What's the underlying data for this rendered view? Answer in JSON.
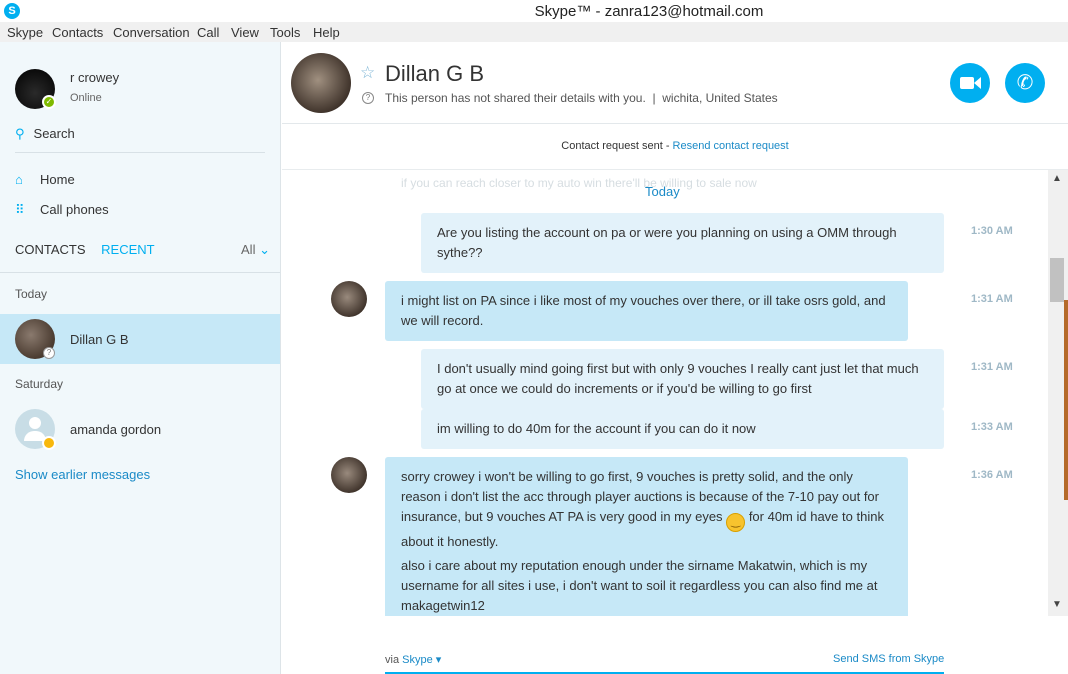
{
  "window": {
    "title": "Skype™ - zanra123@hotmail.com",
    "app_icon": "skype-icon"
  },
  "menu": [
    "Skype",
    "Contacts",
    "Conversation",
    "Call",
    "View",
    "Tools",
    "Help"
  ],
  "sidebar": {
    "profile": {
      "name": "r crowey",
      "status": "Online"
    },
    "search_label": "Search",
    "nav": [
      {
        "label": "Home",
        "icon": "home-icon"
      },
      {
        "label": "Call phones",
        "icon": "dialpad-icon"
      }
    ],
    "tabs": {
      "contacts": "CONTACTS",
      "recent": "RECENT",
      "filter": "All"
    },
    "groups": [
      {
        "label": "Today",
        "items": [
          {
            "name": "Dillan G B",
            "selected": true
          }
        ]
      },
      {
        "label": "Saturday",
        "items": [
          {
            "name": "amanda gordon",
            "selected": false
          }
        ]
      }
    ],
    "show_earlier": "Show earlier messages"
  },
  "contact": {
    "name": "Dillan G B",
    "details_note": "This person has not shared their details with you.",
    "location": "wichita, United States"
  },
  "request_bar": {
    "text": "Contact request sent - ",
    "link": "Resend contact request"
  },
  "conversation": {
    "ghost_text": "if you can reach closer to my auto win there'll be willing to sale now",
    "date_divider": "Today",
    "messages": [
      {
        "dir": "out",
        "time": "1:30 AM",
        "paragraphs": [
          "Are you listing the account on pa or were you planning on using a OMM through sythe??"
        ]
      },
      {
        "dir": "in",
        "time": "1:31 AM",
        "paragraphs": [
          "i might list on PA since i like most of my vouches over there, or ill take osrs gold, and we will record."
        ]
      },
      {
        "dir": "out",
        "time": "1:31 AM",
        "paragraphs": [
          "I don't usually mind going first but with only 9 vouches I really cant just let that much go at once we could do increments or if you'd be willing to go first"
        ]
      },
      {
        "dir": "out",
        "time": "1:33 AM",
        "paragraphs": [
          "im willing to do 40m for the account if you can do it now"
        ]
      },
      {
        "dir": "in",
        "time": "1:36 AM",
        "paragraphs": [
          "sorry crowey i won't be willing to go first, 9 vouches is pretty solid, and the only reason i don't list the acc through player auctions is because of the 7-10 pay out for insurance, but 9 vouches AT PA is very good in my eyes",
          "for 40m id have to think about it honestly.",
          "also i care about my reputation enough under the sirname Makatwin, which is my username for all sites i use, i don't want to soil it regardless you can also find me at makagetwin12"
        ]
      }
    ]
  },
  "footer": {
    "via_label": "via",
    "via_value": "Skype",
    "sms_link": "Send SMS from Skype"
  },
  "colors": {
    "accent": "#00aff0",
    "selected_row": "#c6e8f7",
    "sidebar_bg": "#f1f8fb"
  }
}
